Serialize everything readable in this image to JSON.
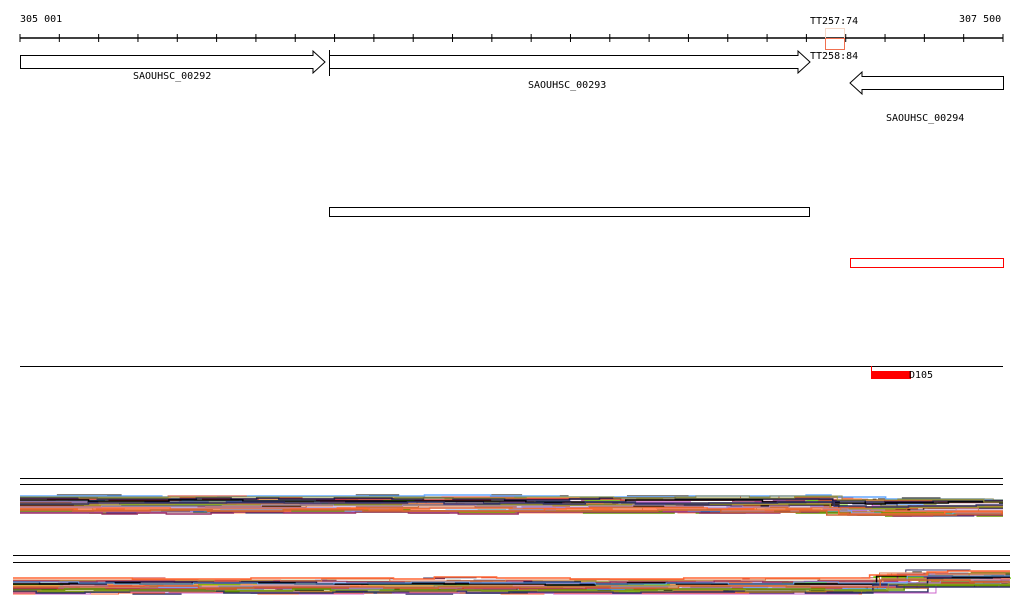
{
  "ruler": {
    "start_label": "305 001",
    "end_label": "307 500",
    "start": 305001,
    "end": 307500
  },
  "genes": [
    {
      "name": "SAOUHSC_00292",
      "strand": "+",
      "start": 305001,
      "end": 305780
    },
    {
      "name": "SAOUHSC_00293",
      "strand": "+",
      "start": 305790,
      "end": 307015
    },
    {
      "name": "SAOUHSC_00294",
      "strand": "-",
      "start": 307115,
      "end": 307500
    }
  ],
  "terminators": {
    "label_top": "TT257:74",
    "label_bottom": "TT258:84"
  },
  "features": {
    "d105_label": "D105"
  },
  "colors": {
    "accent": "#ff0000",
    "terminator": "#f08060"
  }
}
